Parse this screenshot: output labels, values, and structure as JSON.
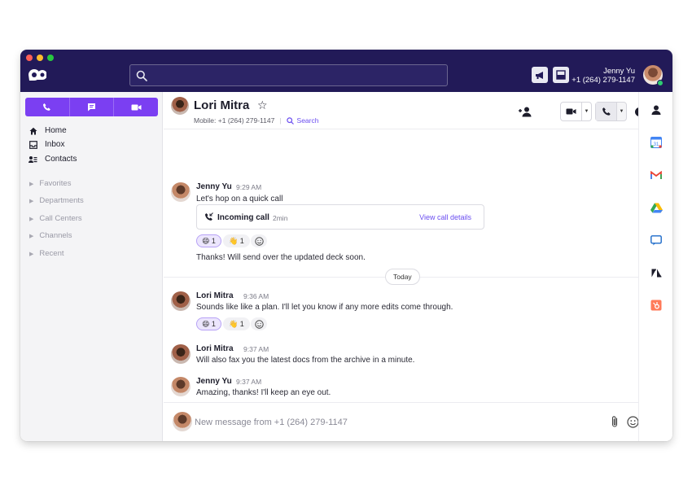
{
  "titlebar": {
    "search_placeholder": "",
    "user_name": "Jenny Yu",
    "user_phone": "+1 (264) 279-1147"
  },
  "sidebar": {
    "nav": [
      {
        "label": "Home",
        "icon": "home-icon"
      },
      {
        "label": "Inbox",
        "icon": "inbox-icon"
      },
      {
        "label": "Contacts",
        "icon": "contacts-icon"
      }
    ],
    "sections": [
      "Favorites",
      "Departments",
      "Call Centers",
      "Channels",
      "Recent"
    ]
  },
  "header": {
    "contact_name": "Lori Mitra",
    "mobile_label": "Mobile: +1 (264) 279-1147",
    "search_link": "Search"
  },
  "messages": [
    {
      "sender": "Jenny Yu",
      "time": "9:29 AM",
      "text": "Let's hop on a quick call"
    },
    {
      "sender": "Lori Mitra",
      "time": "9:36 AM",
      "text": "Sounds like like a plan. I'll let you know if any more edits come through."
    },
    {
      "sender": "Lori Mitra",
      "time": "9:37 AM",
      "text": "Will also fax you the latest docs from the archive in a minute."
    },
    {
      "sender": "Jenny Yu",
      "time": "9:37 AM",
      "text": "Amazing, thanks! I'll keep an eye out."
    }
  ],
  "call_card": {
    "title": "Incoming call",
    "duration": "2min",
    "link": "View call details"
  },
  "followup_text": "Thanks! Will send over the updated deck soon.",
  "reactions": {
    "first": [
      {
        "emoji": "😄",
        "count": "1"
      },
      {
        "emoji": "👋",
        "count": "1"
      }
    ],
    "second": [
      {
        "emoji": "😄",
        "count": "1"
      },
      {
        "emoji": "👋",
        "count": "1"
      }
    ]
  },
  "divider_label": "Today",
  "composer": {
    "placeholder": "New message from +1 (264) 279-1147"
  },
  "colors": {
    "titlebar": "#221a58",
    "accent": "#7b3ff2",
    "link": "#6a4df0"
  }
}
